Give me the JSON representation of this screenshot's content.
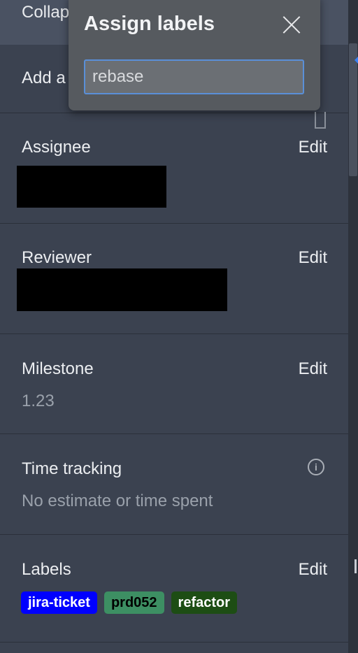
{
  "header": {
    "collapse_text": "Collap"
  },
  "todo": {
    "add_text": "Add a"
  },
  "assignee": {
    "label": "Assignee",
    "edit_label": "Edit"
  },
  "reviewer": {
    "label": "Reviewer",
    "edit_label": "Edit"
  },
  "milestone": {
    "label": "Milestone",
    "edit_label": "Edit",
    "value": "1.23"
  },
  "time_tracking": {
    "label": "Time tracking",
    "value": "No estimate or time spent",
    "icon": "info-icon"
  },
  "labels": {
    "label": "Labels",
    "edit_label": "Edit",
    "chips": [
      {
        "text": "jira-ticket",
        "bg": "#0000ff",
        "fg": "#ffffff"
      },
      {
        "text": "prd052",
        "bg": "#3d8f63",
        "fg": "#000000"
      },
      {
        "text": "refactor",
        "bg": "#1d4d14",
        "fg": "#ffffff"
      }
    ]
  },
  "popover": {
    "title": "Assign labels",
    "search_value": "rebase",
    "close_icon": "close-icon"
  },
  "colors": {
    "sidebar_bg": "#3b4250",
    "popover_bg": "#565a5f",
    "focus_border": "#5a8fd8"
  }
}
